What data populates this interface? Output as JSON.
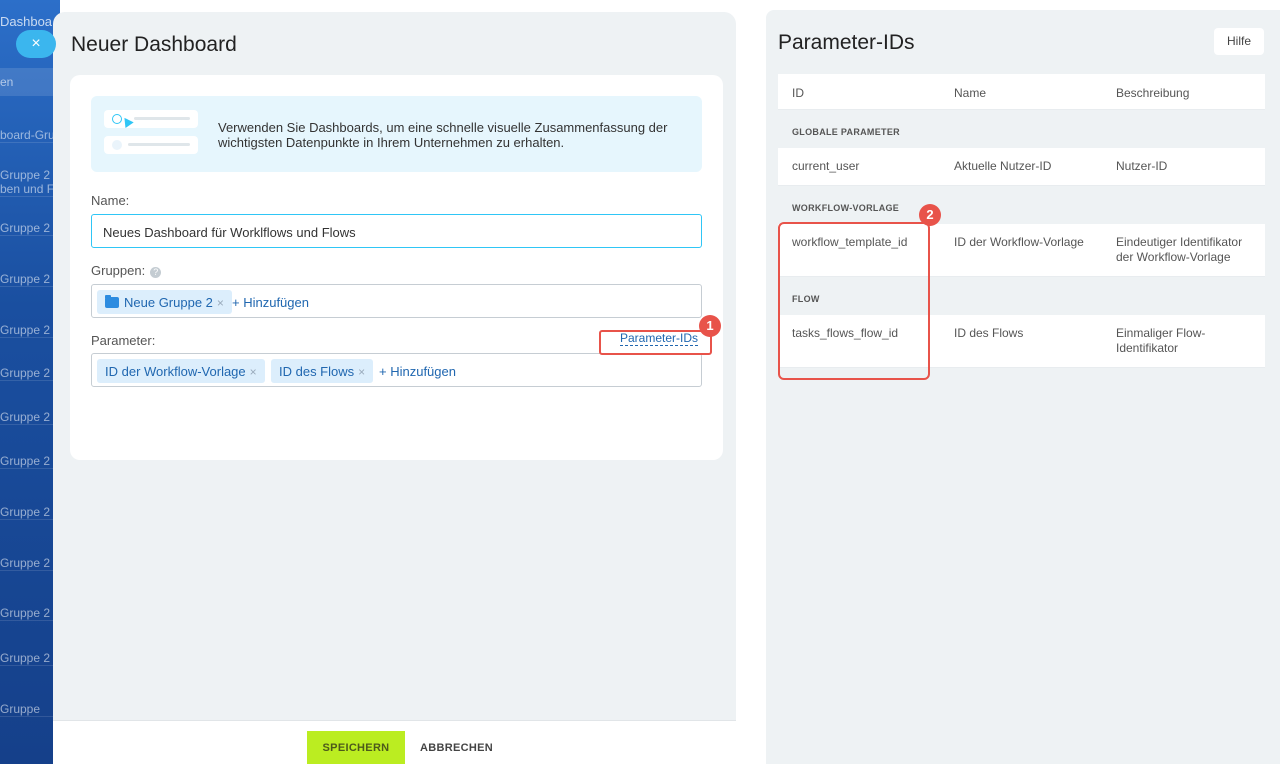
{
  "background_app": {
    "title": "Dashboa",
    "search_placeholder": "en",
    "rows": [
      "board-Gru",
      "Gruppe 2\nben und F",
      "Gruppe 2",
      "Gruppe 2",
      "Gruppe 2",
      "Gruppe 2",
      "Gruppe 2",
      "Gruppe 2",
      "Gruppe 2",
      "Gruppe 2",
      "Gruppe 2",
      "Gruppe 2",
      "Gruppe"
    ]
  },
  "slider": {
    "close_symbol": "×",
    "title": "Neuer Dashboard",
    "hint_text": "Verwenden Sie Dashboards, um eine schnelle visuelle Zusammenfassung der wichtigsten Datenpunkte in Ihrem Unternehmen zu erhalten.",
    "name_label": "Name:",
    "name_value": "Neues Dashboard für Worklflows und Flows",
    "groups_label": "Gruppen:",
    "groups": [
      {
        "label": "Neue Gruppe 2",
        "icon": "folder-icon"
      }
    ],
    "groups_add": "+ Hinzufügen",
    "params_label": "Parameter:",
    "params_link": "Parameter-IDs",
    "params": [
      {
        "label": "ID der Workflow-Vorlage"
      },
      {
        "label": "ID des Flows"
      }
    ],
    "params_add": "+ Hinzufügen",
    "remove_symbol": "×",
    "help_symbol": "?"
  },
  "footer": {
    "save_label": "SPEICHERN",
    "cancel_label": "ABBRECHEN"
  },
  "parameter_ids": {
    "title": "Parameter-IDs",
    "help_label": "Hilfe",
    "columns": [
      "ID",
      "Name",
      "Beschreibung"
    ],
    "sections": [
      {
        "title": "GLOBALE PARAMETER",
        "rows": [
          {
            "id": "current_user",
            "name": "Aktuelle Nutzer-ID",
            "description": "Nutzer-ID"
          }
        ]
      },
      {
        "title": "WORKFLOW-VORLAGE",
        "rows": [
          {
            "id": "workflow_template_id",
            "name": "ID der Workflow-Vorlage",
            "description": "Eindeutiger Identifikator der Workflow-Vorlage"
          }
        ]
      },
      {
        "title": "FLOW",
        "rows": [
          {
            "id": "tasks_flows_flow_id",
            "name": "ID des Flows",
            "description": "Einmaliger Flow-Identifikator"
          }
        ]
      }
    ]
  },
  "annotations": {
    "badge1": "1",
    "badge2": "2"
  },
  "colors": {
    "accent": "#2fc6f6",
    "save_button": "#bbed21",
    "annotation": "#e8534a",
    "link": "#2067b0"
  }
}
